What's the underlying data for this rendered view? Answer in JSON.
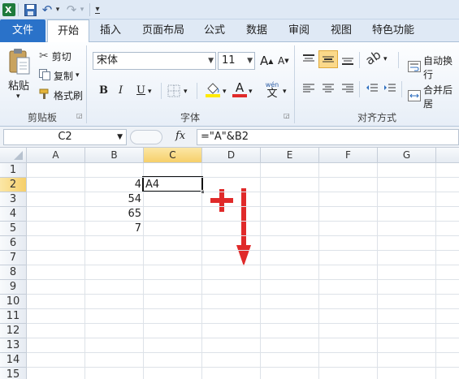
{
  "qat": {
    "undo_symbol": "↶",
    "redo_symbol": "↷",
    "dropdown_symbol": "▾"
  },
  "tabs": [
    "文件",
    "开始",
    "插入",
    "页面布局",
    "公式",
    "数据",
    "审阅",
    "视图",
    "特色功能"
  ],
  "clipboard": {
    "paste": "粘贴",
    "cut": "剪切",
    "copy": "复制",
    "format_painter": "格式刷",
    "group": "剪贴板"
  },
  "font": {
    "name": "宋体",
    "size": "11",
    "grow": "A",
    "shrink": "A",
    "bold": "B",
    "italic": "I",
    "underline": "U",
    "font_color_letter": "A",
    "wen_top": "wén",
    "wen": "文",
    "group": "字体"
  },
  "alignment": {
    "wrap": "自动换行",
    "merge": "合并后居",
    "group": "对齐方式"
  },
  "formula_bar": {
    "name_box": "C2",
    "fx": "fx",
    "formula": "=\"A\"&B2"
  },
  "grid": {
    "columns": [
      "A",
      "B",
      "C",
      "D",
      "E",
      "F",
      "G"
    ],
    "selected_column": "C",
    "rows": [
      "1",
      "2",
      "3",
      "4",
      "5",
      "6",
      "7",
      "8",
      "9",
      "10",
      "11",
      "12",
      "13",
      "14",
      "15"
    ],
    "selected_row": "2",
    "b_values": [
      "4",
      "54",
      "65",
      "7"
    ],
    "c2_value": "A4"
  },
  "colors": {
    "file_tab": "#2a72c9",
    "annotation": "#e02a2a",
    "selection_header": "#f6cf6a"
  }
}
